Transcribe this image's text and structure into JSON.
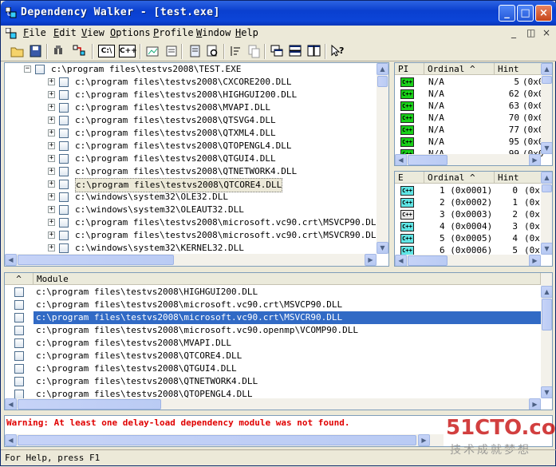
{
  "window": {
    "title": "Dependency Walker - [test.exe]"
  },
  "menu": [
    "File",
    "Edit",
    "View",
    "Options",
    "Profile",
    "Window",
    "Help"
  ],
  "menu_underline": [
    "F",
    "E",
    "V",
    "O",
    "P",
    "W",
    "H"
  ],
  "toolbar": {
    "labels": [
      "C:\\",
      "C++"
    ]
  },
  "tree": {
    "root": "c:\\program files\\testvs2008\\TEST.EXE",
    "children": [
      "c:\\program files\\testvs2008\\CXCORE200.DLL",
      "c:\\program files\\testvs2008\\HIGHGUI200.DLL",
      "c:\\program files\\testvs2008\\MVAPI.DLL",
      "c:\\program files\\testvs2008\\QTSVG4.DLL",
      "c:\\program files\\testvs2008\\QTXML4.DLL",
      "c:\\program files\\testvs2008\\QTOPENGL4.DLL",
      "c:\\program files\\testvs2008\\QTGUI4.DLL",
      "c:\\program files\\testvs2008\\QTNETWORK4.DLL",
      "c:\\program files\\testvs2008\\QTCORE4.DLL",
      "c:\\windows\\system32\\OLE32.DLL",
      "c:\\windows\\system32\\OLEAUT32.DLL",
      "c:\\program files\\testvs2008\\microsoft.vc90.crt\\MSVCP90.DLL",
      "c:\\program files\\testvs2008\\microsoft.vc90.crt\\MSVCR90.DLL",
      "c:\\windows\\system32\\KERNEL32.DLL"
    ]
  },
  "imports": {
    "headers": [
      "PI",
      "Ordinal ^",
      "Hint"
    ],
    "rows": [
      {
        "ordinal": "N/A",
        "hint": "5",
        "extra": "(0x0"
      },
      {
        "ordinal": "N/A",
        "hint": "62",
        "extra": "(0x0"
      },
      {
        "ordinal": "N/A",
        "hint": "63",
        "extra": "(0x0"
      },
      {
        "ordinal": "N/A",
        "hint": "70",
        "extra": "(0x0"
      },
      {
        "ordinal": "N/A",
        "hint": "77",
        "extra": "(0x0"
      },
      {
        "ordinal": "N/A",
        "hint": "95",
        "extra": "(0x0"
      },
      {
        "ordinal": "N/A",
        "hint": "99",
        "extra": "(0x0"
      }
    ]
  },
  "exports": {
    "headers": [
      "E",
      "Ordinal ^",
      "Hint"
    ],
    "rows": [
      {
        "ordinal": "1 (0x0001)",
        "hint": "0",
        "extra": "(0x"
      },
      {
        "ordinal": "2 (0x0002)",
        "hint": "1",
        "extra": "(0x"
      },
      {
        "ordinal": "3 (0x0003)",
        "hint": "2",
        "extra": "(0x"
      },
      {
        "ordinal": "4 (0x0004)",
        "hint": "3",
        "extra": "(0x"
      },
      {
        "ordinal": "5 (0x0005)",
        "hint": "4",
        "extra": "(0x"
      },
      {
        "ordinal": "6 (0x0006)",
        "hint": "5",
        "extra": "(0x"
      }
    ]
  },
  "modules": {
    "header_sort": "^",
    "header": "Module",
    "rows": [
      "c:\\program files\\testvs2008\\HIGHGUI200.DLL",
      "c:\\program files\\testvs2008\\microsoft.vc90.crt\\MSVCP90.DLL",
      "c:\\program files\\testvs2008\\microsoft.vc90.crt\\MSVCR90.DLL",
      "c:\\program files\\testvs2008\\microsoft.vc90.openmp\\VCOMP90.DLL",
      "c:\\program files\\testvs2008\\MVAPI.DLL",
      "c:\\program files\\testvs2008\\QTCORE4.DLL",
      "c:\\program files\\testvs2008\\QTGUI4.DLL",
      "c:\\program files\\testvs2008\\QTNETWORK4.DLL",
      "c:\\program files\\testvs2008\\QTOPENGL4.DLL"
    ],
    "selected_index": 2
  },
  "log": {
    "warning": "Warning: At least one delay-load dependency module was not found."
  },
  "status": "For Help, press F1",
  "watermark": {
    "brand": "51CTO.com",
    "slogan": "技术成就梦想"
  }
}
